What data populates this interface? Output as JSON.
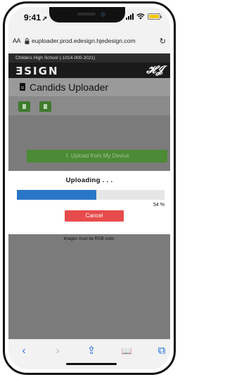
{
  "status": {
    "time": "9:41",
    "location_glyph": "➚"
  },
  "browser": {
    "aa": "AA",
    "url": "euploader.prod.edesign.hjedesign.com",
    "reload_glyph": "↻"
  },
  "site": {
    "school": "Childers High School (-1014-000-2021)",
    "brand": "ƎSIGN",
    "brand_mark": "𝓗𝓙",
    "page_title": "Candids Uploader",
    "upload_label": "Upload from My Device"
  },
  "dialog": {
    "title": "Uploading . . .",
    "progress": 0.54,
    "progress_text": "54 %",
    "cancel_label": "Cancel",
    "progress_color": "#2a77c8",
    "cancel_color": "#e84b4b"
  },
  "note": "Images must be RGB color.",
  "toolbar": {
    "back": "‹",
    "forward": "›",
    "share": "⇪",
    "bookmarks": "📖",
    "tabs": "⧉"
  }
}
